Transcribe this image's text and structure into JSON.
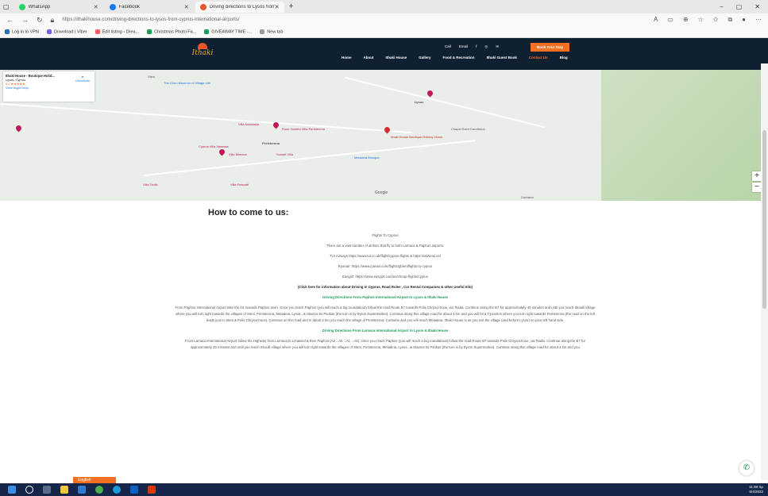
{
  "tabs": [
    {
      "label": "WhatsApp",
      "color": "#25d366"
    },
    {
      "label": "Facebook",
      "color": "#1877f2"
    },
    {
      "label": "Driving directions to Lysos from",
      "color": "#e8552a"
    }
  ],
  "new_tab": "+",
  "window_controls": [
    "–",
    "▢",
    "✕"
  ],
  "address_url": "https://ithakihouse.com/driving-directions-to-lysos-from-cyprus-international-airports/",
  "bookmarks": [
    "Log in to VPN",
    "Download | Viber",
    "Edit listing ‹ Drea...",
    "Christmas Photo Fa...",
    "GIVEAWAY TIME -...",
    "New tab"
  ],
  "site": {
    "logo": "Ithaki",
    "menu": [
      "Home",
      "About",
      "Ithaki House",
      "Gallery",
      "Food & Recreation",
      "Ithaki Guest Book",
      "Contact Us",
      "Blog"
    ],
    "contacts": [
      "Call",
      "Email",
      "f",
      "◎",
      "✉"
    ],
    "book_button": "Book Your Stay"
  },
  "map": {
    "card_title": "Ithaki House - Boutique Holid...",
    "card_address": "Lysos, Cyprus",
    "card_rating": "5.0 ★★★★★",
    "card_link": "View larger map",
    "directions": "Directions",
    "labels": [
      "The Oven Museum of Village Life",
      "Villa Anastasia",
      "Rose Garden Villa Peristerona",
      "Peristerona",
      "Ithaki House Boutique Holiday Home",
      "Meladeia Mosque",
      "Lysos",
      "Chapel Saint Dorotheus",
      "Cyprus Villa Vanessa",
      "Villa Mimosa",
      "Sunset Villa",
      "Villa Frascati",
      "Villa Tsolis",
      "Steni",
      "Zacharia",
      "Google"
    ],
    "zoom_in": "+",
    "zoom_out": "−"
  },
  "content": {
    "heading": "How to come to us:",
    "flights_title": "Flights To Cyprus",
    "airlines": "There are a vast number of airlines that fly to both Larnaca & Paphos airports.",
    "tui": "TUI Airways https://www.tui.co.uk/flight/cyprus-flights & https://www.tui.es/",
    "ryanair": "Ryanair: https://www.ryanair.com/flights/gb/en/flights-to-cyprus",
    "easyjet": "Easyjet: https://www.easyjet.com/en/cheap-flights/cyprus",
    "info": "(Click here for information about Driving in Cyprus, Road Rules , Car Rental Companies & other Useful Info)",
    "paphos_title": "Driving Directions From Paphos International Airport to Lysos & Ithaki House",
    "paphos_text": "From Paphos International Airport take the A6 towards Paphos town. Once you reach Paphos (you will reach a big roundabout) follow the road Route B7 towards Polis Chrysochous, via Tsada. Continue along the B7 for approximately 40 minutes and until you reach Skoulli village where you will turn right towards the villages of Steni, Peristerona, Meladeia, Lysos...& Stavros tis Psokas (the turn is by Byron Supermarket). Continue along this village road for about 4 km and you will hit a T-junction where you turn right towards Peristerona (the road on the left leads you to Steni & Polis Chrysochous). Continue on this road and in about 2 km you reach the village of Peristerona. Contuine and you will reach Meladeia. Ithaki House is as you exit the village (and before Lysos) on your left hand side.",
    "larnaca_title": "Driving Directions From Larnaca International Airport to Lysos & Ithaki House",
    "larnaca_text": "From Larnaca International Airport follow the Highway from Larnaca to Limassol & then Paphos (A3→A5→A1→A6). Once you reach Paphos (you will reach a big roundabout) follow the road Route B7 towards Polis Chrysochous, via Tsada. Continue along the B7 for approximately 40 minutes and until you reach Skoulli village where you will turn right towards the villages of Steni, Peristerona, Meladeia, Lysos...& Stavros tis Psokas (the turn is by Byron Supermarket). Continue along this village road for about 4 km and you"
  },
  "language_button": "English",
  "clock": {
    "time": "11:38 πμ",
    "date": "6/4/2022"
  }
}
